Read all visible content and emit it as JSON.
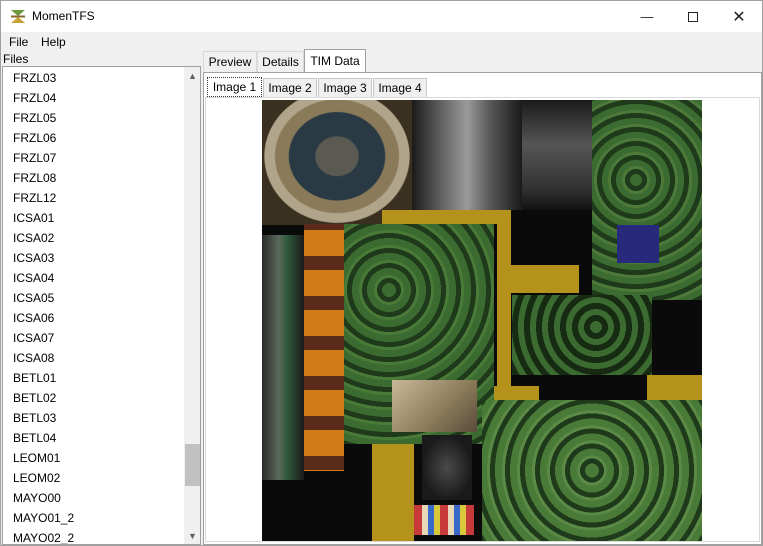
{
  "window": {
    "title": "MomenTFS"
  },
  "menu": {
    "file": "File",
    "help": "Help"
  },
  "sidebar": {
    "label": "Files",
    "items": [
      "FRZL03",
      "FRZL04",
      "FRZL05",
      "FRZL06",
      "FRZL07",
      "FRZL08",
      "FRZL12",
      "ICSA01",
      "ICSA02",
      "ICSA03",
      "ICSA04",
      "ICSA05",
      "ICSA06",
      "ICSA07",
      "ICSA08",
      "BETL01",
      "BETL02",
      "BETL03",
      "BETL04",
      "LEOM01",
      "LEOM02",
      "MAYO00",
      "MAYO01_2",
      "MAYO02_2"
    ]
  },
  "tabs": {
    "preview": "Preview",
    "details": "Details",
    "tim_data": "TIM Data"
  },
  "subtabs": {
    "image1": "Image 1",
    "image2": "Image 2",
    "image3": "Image 3",
    "image4": "Image 4"
  },
  "icons": {
    "minimize": "minimize-icon",
    "maximize": "maximize-icon",
    "close": "close-icon",
    "scroll_up": "chevron-up-icon",
    "scroll_down": "chevron-down-icon"
  },
  "colors": {
    "accent_gold": "#b5921c",
    "foliage": "#2e5a28",
    "texture_bg": "#0a0a0a",
    "navy": "#27297a"
  }
}
